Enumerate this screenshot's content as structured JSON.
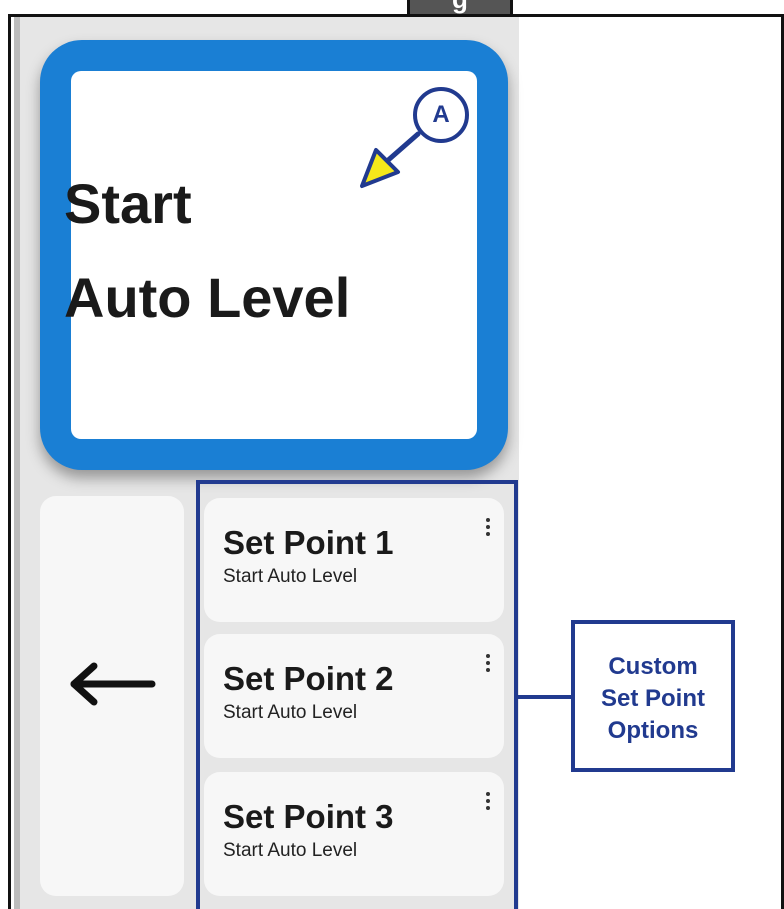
{
  "figure_tab": {
    "label": "g"
  },
  "start_button": {
    "line1": "Start",
    "line2": "Auto Level"
  },
  "callout": {
    "label": "A"
  },
  "back_button": {
    "icon": "left-arrow-icon"
  },
  "set_points": [
    {
      "title": "Set Point 1",
      "subtitle": "Start Auto Level"
    },
    {
      "title": "Set Point 2",
      "subtitle": "Start Auto Level"
    },
    {
      "title": "Set Point 3",
      "subtitle": "Start Auto Level"
    }
  ],
  "annotation": {
    "line1": "Custom",
    "line2": "Set Point",
    "line3": "Options"
  },
  "colors": {
    "accent_blue": "#1a7fd4",
    "annotation_navy": "#213a8f",
    "callout_arrow_fill": "#f5e81a"
  }
}
